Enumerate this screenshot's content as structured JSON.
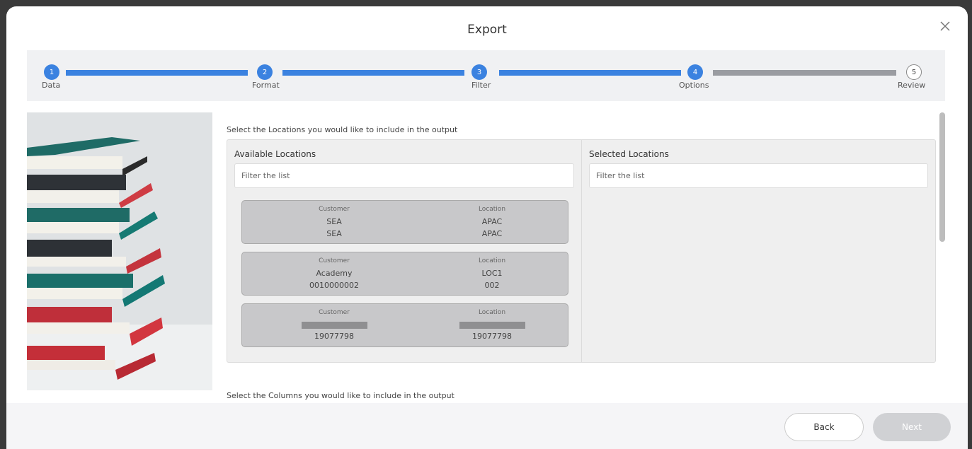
{
  "dialog": {
    "title": "Export"
  },
  "stepper": {
    "steps": [
      {
        "number": "1",
        "label": "Data",
        "state": "done"
      },
      {
        "number": "2",
        "label": "Format",
        "state": "done"
      },
      {
        "number": "3",
        "label": "Filter",
        "state": "done"
      },
      {
        "number": "4",
        "label": "Options",
        "state": "done"
      },
      {
        "number": "5",
        "label": "Review",
        "state": "todo"
      }
    ],
    "accent_color": "#3b82e0",
    "inactive_color": "#9a9ca1"
  },
  "locations": {
    "instruction": "Select the Locations you would like to include in the output",
    "available": {
      "title": "Available Locations",
      "filter_placeholder": "Filter the list",
      "items": [
        {
          "customer_label": "Customer",
          "location_label": "Location",
          "customer_line1": "SEA",
          "customer_line2": "SEA",
          "location_line1": "APAC",
          "location_line2": "APAC"
        },
        {
          "customer_label": "Customer",
          "location_label": "Location",
          "customer_line1": "Academy",
          "customer_line2": "0010000002",
          "location_line1": "LOC1",
          "location_line2": "002"
        },
        {
          "customer_label": "Customer",
          "location_label": "Location",
          "customer_line1": "",
          "customer_line2": "19077798",
          "location_line1": "",
          "location_line2": "19077798"
        }
      ]
    },
    "selected": {
      "title": "Selected Locations",
      "filter_placeholder": "Filter the list"
    }
  },
  "columns": {
    "instruction": "Select the Columns you would like to include in the output"
  },
  "footer": {
    "back_label": "Back",
    "next_label": "Next"
  }
}
